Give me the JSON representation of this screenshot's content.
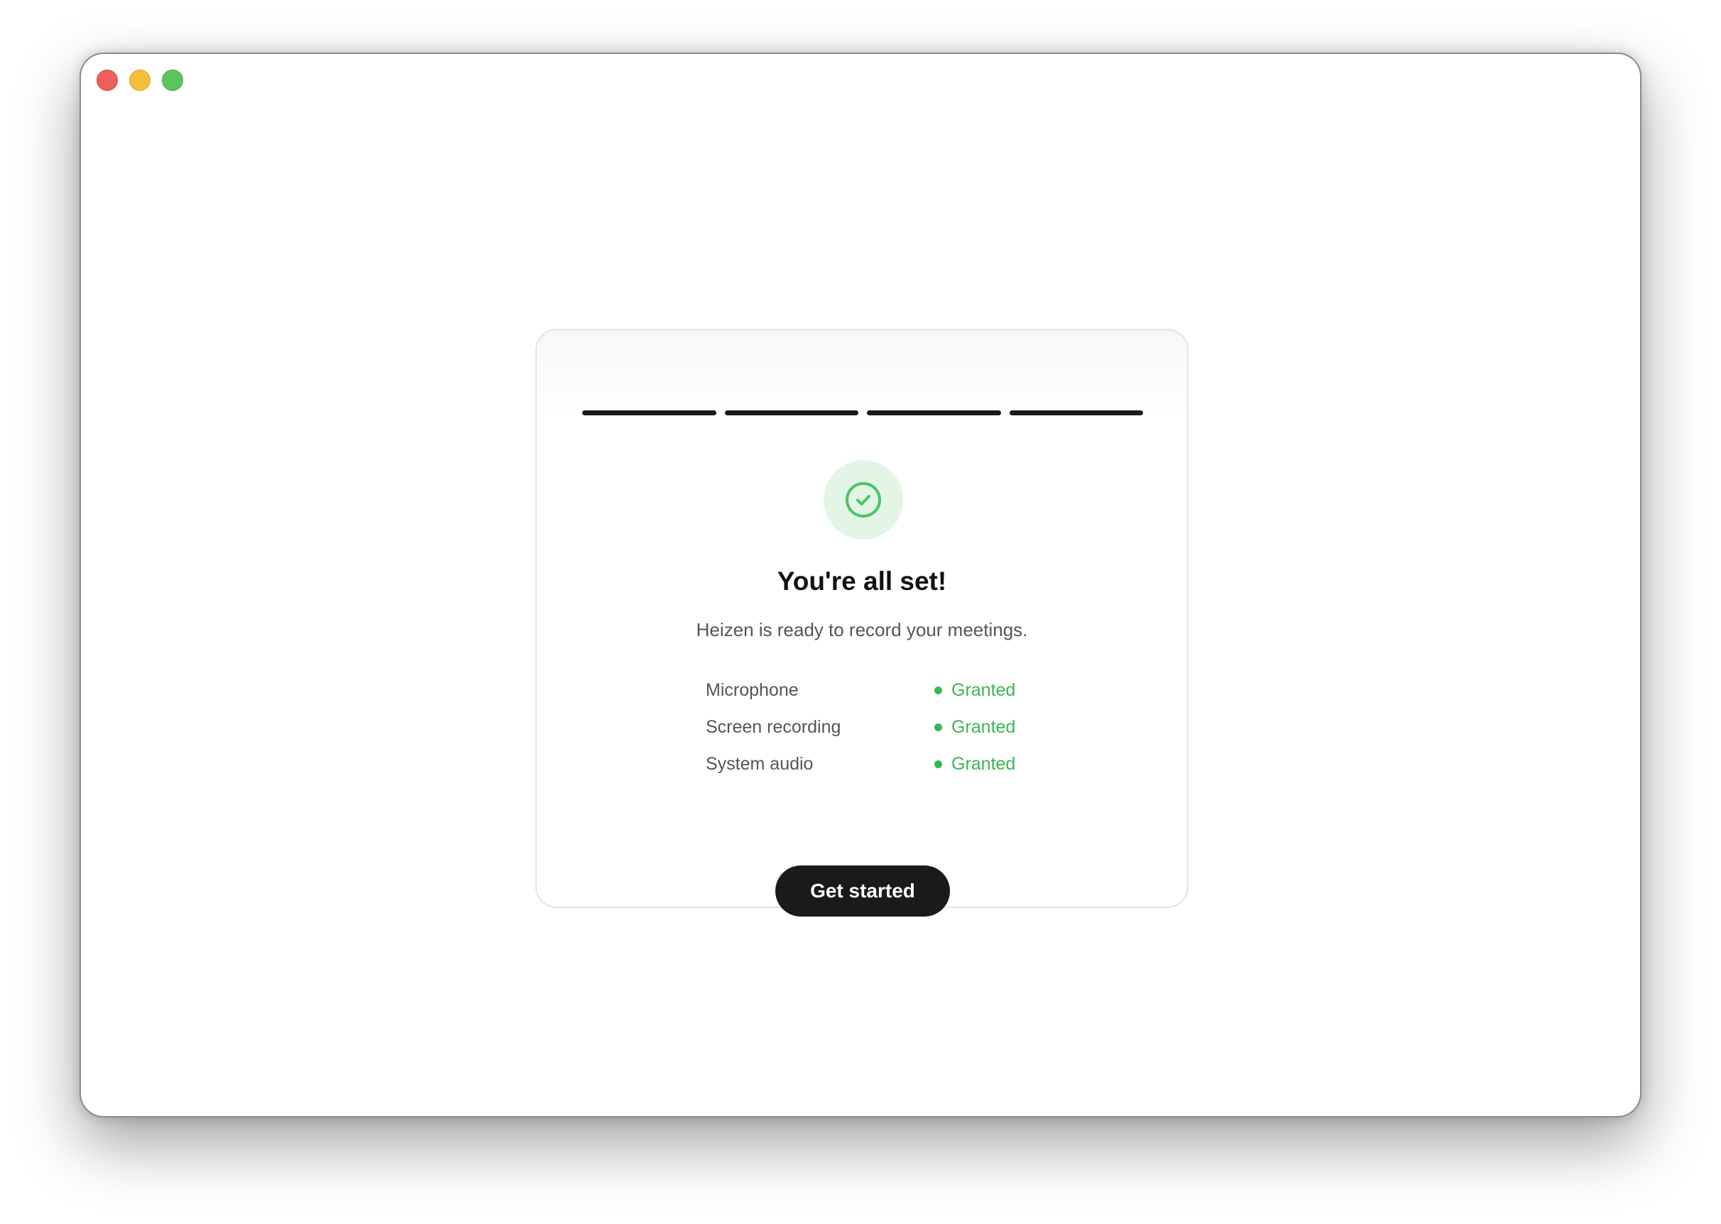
{
  "window": {
    "traffic_lights": [
      "close",
      "minimize",
      "zoom"
    ]
  },
  "onboarding": {
    "progress_steps_total": 4,
    "progress_steps_completed": 4,
    "success_icon": "check-circle-icon",
    "accent_color": "#3cb553",
    "title": "You're all set!",
    "subtitle": "Heizen is ready to record your meetings.",
    "permissions": [
      {
        "label": "Microphone",
        "status": "Granted"
      },
      {
        "label": "Screen recording",
        "status": "Granted"
      },
      {
        "label": "System audio",
        "status": "Granted"
      }
    ],
    "cta_label": "Get started"
  }
}
